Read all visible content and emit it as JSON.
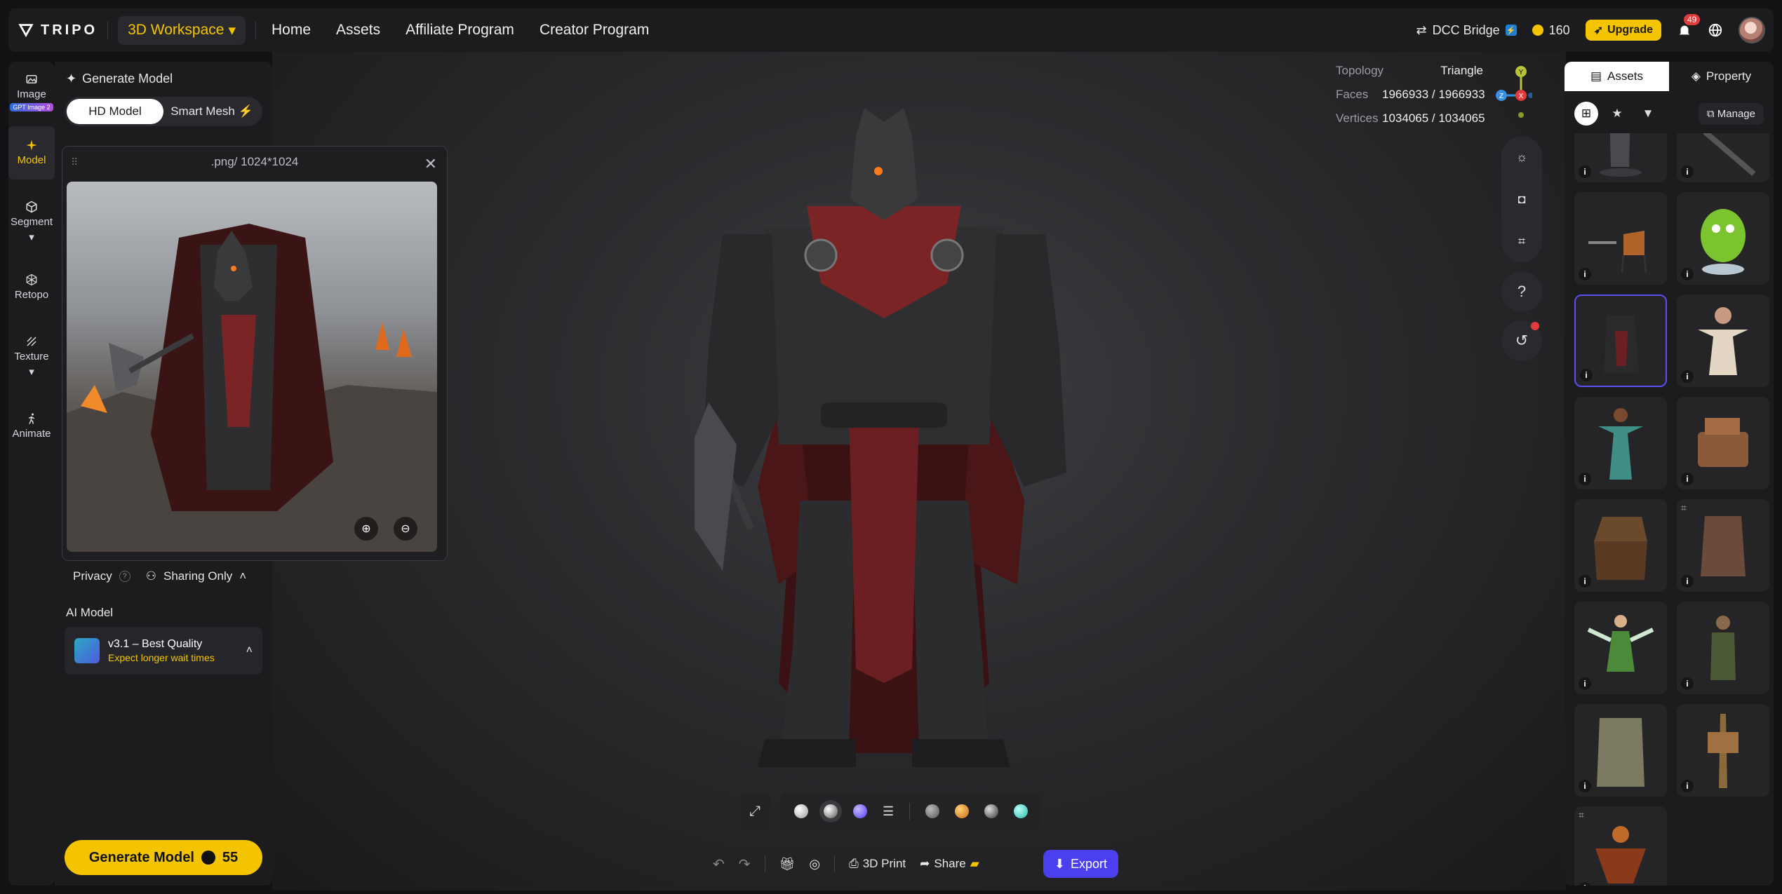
{
  "topbar": {
    "brand": "TRIPO",
    "workspace": "3D Workspace",
    "nav": [
      "Home",
      "Assets",
      "Affiliate Program",
      "Creator Program"
    ],
    "dcc_bridge": "DCC Bridge",
    "credits": "160",
    "upgrade": "Upgrade",
    "notifications": "49"
  },
  "rail": {
    "image": "Image",
    "gpt_badge": "GPT Image 2",
    "model": "Model",
    "segment": "Segment",
    "retopo": "Retopo",
    "texture": "Texture",
    "animate": "Animate"
  },
  "panel": {
    "title": "Generate Model",
    "tab_hd": "HD Model",
    "tab_smart": "Smart Mesh",
    "privacy": "Privacy",
    "sharing": "Sharing Only",
    "ai_label": "AI Model",
    "ai_name": "v3.1 – Best Quality",
    "ai_note": "Expect longer wait times",
    "generate": "Generate Model",
    "generate_cost": "55"
  },
  "preview": {
    "title": ".png/ 1024*1024"
  },
  "stats": {
    "topology_k": "Topology",
    "topology_v": "Triangle",
    "faces_k": "Faces",
    "faces_v": "1966933 / 1966933",
    "vertices_k": "Vertices",
    "vertices_v": "1034065 / 1034065"
  },
  "gizmo": {
    "y": "Y",
    "z": "Z",
    "x": "X"
  },
  "bottombar": {
    "print": "3D Print",
    "share": "Share",
    "export": "Export"
  },
  "rpanel": {
    "assets_tab": "Assets",
    "property_tab": "Property",
    "manage": "Manage"
  },
  "colors": {
    "accent": "#f5c400",
    "export": "#4b3ff0",
    "selected_border": "#5a4ff0"
  }
}
